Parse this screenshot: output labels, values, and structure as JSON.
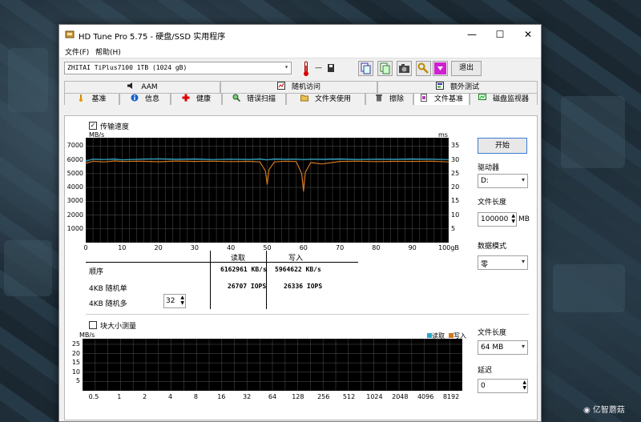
{
  "window": {
    "title": "HD Tune Pro 5.75 - 硬盘/SSD 实用程序",
    "minimize": "—",
    "maximize": "☐",
    "close": "✕"
  },
  "menu": {
    "file": "文件(F)",
    "help": "帮助(H)"
  },
  "toolbar": {
    "drive": "ZHITAI TiPlus7100 1TB (1024 gB)",
    "temp": "—",
    "exit": "退出"
  },
  "tabs_row1": [
    "AAM",
    "随机访问",
    "额外测试"
  ],
  "tabs_row2": [
    "基准",
    "信息",
    "健康",
    "错误扫描",
    "文件夹使用",
    "擦除",
    "文件基准",
    "磁盘监视器"
  ],
  "transfer": {
    "checkbox_label": "传输速度",
    "checked": true,
    "y_unit": "MB/s",
    "y2_unit": "ms",
    "y_ticks": [
      "7000",
      "6000",
      "5000",
      "4000",
      "3000",
      "2000",
      "1000"
    ],
    "y2_ticks": [
      "35",
      "30",
      "25",
      "20",
      "15",
      "10",
      "5"
    ],
    "x_ticks": [
      "0",
      "10",
      "20",
      "30",
      "40",
      "50",
      "60",
      "70",
      "80",
      "90",
      "100gB"
    ]
  },
  "results": {
    "col_read": "读取",
    "col_write": "写入",
    "rows": [
      {
        "label": "顺序",
        "read": "6162961 KB/s",
        "write": "5964622 KB/s"
      },
      {
        "label": "4KB 随机单",
        "read": "26707 IOPS",
        "write": "26336 IOPS"
      },
      {
        "label": "4KB 随机多",
        "read": "",
        "write": ""
      }
    ],
    "queue_depth": "32"
  },
  "block": {
    "checkbox_label": "块大小测量",
    "checked": false,
    "y_unit": "MB/s",
    "legend_read": "读取",
    "legend_write": "写入",
    "y_ticks": [
      "25",
      "20",
      "15",
      "10",
      "5"
    ],
    "x_ticks": [
      "0.5",
      "1",
      "2",
      "4",
      "8",
      "16",
      "32",
      "64",
      "128",
      "256",
      "512",
      "1024",
      "2048",
      "4096",
      "8192"
    ]
  },
  "side": {
    "start": "开始",
    "drive_label": "驱动器",
    "drive_value": "D:",
    "file_length_label": "文件长度",
    "file_length_value": "100000",
    "file_length_unit": "MB",
    "data_mode_label": "数据模式",
    "data_mode_value": "零",
    "file_length2_label": "文件长度",
    "file_length2_value": "64 MB",
    "delay_label": "延迟",
    "delay_value": "0"
  },
  "colors": {
    "read": "#2aa7c9",
    "write": "#d2781e",
    "grid": "#444444",
    "graph_bg": "#000000"
  },
  "chart_data": {
    "type": "line",
    "x_label": "gB",
    "xlim": [
      0,
      100
    ],
    "ylim": [
      0,
      7000
    ],
    "series": [
      {
        "name": "读取",
        "x": [
          0,
          2,
          5,
          8,
          10,
          15,
          20,
          25,
          30,
          35,
          40,
          45,
          48,
          50,
          52,
          55,
          58,
          60,
          62,
          65,
          70,
          75,
          80,
          85,
          90,
          95,
          100
        ],
        "y": [
          5900,
          6050,
          6020,
          6060,
          6000,
          6050,
          6080,
          6040,
          6060,
          6020,
          6050,
          6030,
          6060,
          6000,
          6060,
          6040,
          6050,
          6020,
          6050,
          6040,
          6060,
          6030,
          6050,
          6040,
          6060,
          6050,
          6020
        ]
      },
      {
        "name": "写入",
        "x": [
          0,
          2,
          5,
          8,
          10,
          15,
          20,
          25,
          30,
          35,
          40,
          45,
          48,
          49.5,
          50,
          50.5,
          52,
          55,
          58,
          59.5,
          60,
          60.5,
          62,
          65,
          70,
          75,
          80,
          85,
          90,
          95,
          100
        ],
        "y": [
          5750,
          5900,
          5850,
          5920,
          5880,
          5900,
          5860,
          5910,
          5880,
          5900,
          5870,
          5890,
          5850,
          5200,
          4200,
          5300,
          5850,
          5900,
          5870,
          5000,
          3700,
          5100,
          5800,
          5700,
          5880,
          5900,
          5870,
          5890,
          5880,
          5900,
          5850
        ]
      }
    ]
  }
}
